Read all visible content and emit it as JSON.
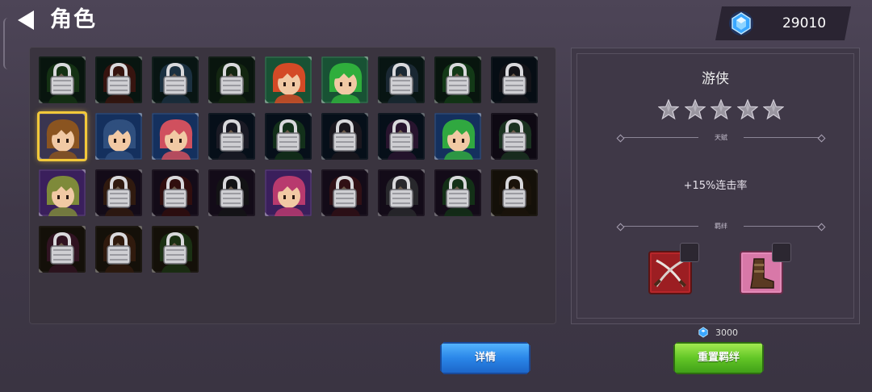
{
  "header": {
    "title": "角色",
    "back_icon": "back-arrow-icon"
  },
  "currency": {
    "icon": "blue-gem-icon",
    "amount": "29010"
  },
  "roster": {
    "slots": [
      {
        "bg": "#12301f",
        "hair": "#2e6e2c",
        "locked": true
      },
      {
        "bg": "#123025",
        "hair": "#7a2e22",
        "locked": true
      },
      {
        "bg": "#12302a",
        "hair": "#3c6a8e",
        "locked": true
      },
      {
        "bg": "#16301f",
        "hair": "#2c5426",
        "locked": true
      },
      {
        "bg": "#185234",
        "hair": "#d44a26",
        "locked": false
      },
      {
        "bg": "#185234",
        "hair": "#2fae3c",
        "locked": false
      },
      {
        "bg": "#12302a",
        "hair": "#3b5a72",
        "locked": true
      },
      {
        "bg": "#123020",
        "hair": "#2a7e34",
        "locked": true
      },
      {
        "bg": "#0f1e2e",
        "hair": "#2c2c36",
        "locked": true
      },
      {
        "bg": "#3a3550",
        "hair": "#8a5420",
        "locked": false
      },
      {
        "bg": "#14305e",
        "hair": "#2f4f7e",
        "locked": false
      },
      {
        "bg": "#14305e",
        "hair": "#d0505e",
        "locked": false
      },
      {
        "bg": "#0f2238",
        "hair": "#3a3a50",
        "locked": true
      },
      {
        "bg": "#0f2238",
        "hair": "#2a6a3a",
        "locked": true
      },
      {
        "bg": "#0f2238",
        "hair": "#3a3444",
        "locked": true
      },
      {
        "bg": "#0f2238",
        "hair": "#5a2e66",
        "locked": true
      },
      {
        "bg": "#14305e",
        "hair": "#30a840",
        "locked": false
      },
      {
        "bg": "#20142c",
        "hair": "#3a6f48",
        "locked": true
      },
      {
        "bg": "#3a1f5c",
        "hair": "#7e8a3a",
        "locked": false
      },
      {
        "bg": "#2a1a36",
        "hair": "#6a3a22",
        "locked": true
      },
      {
        "bg": "#2a1a36",
        "hair": "#6a2020",
        "locked": true
      },
      {
        "bg": "#2a1a36",
        "hair": "#2c2c30",
        "locked": true
      },
      {
        "bg": "#3a1f5c",
        "hair": "#b83a6e",
        "locked": false
      },
      {
        "bg": "#2a1a36",
        "hair": "#6a2430",
        "locked": true
      },
      {
        "bg": "#2a1a36",
        "hair": "#5a5a62",
        "locked": true
      },
      {
        "bg": "#2a1a36",
        "hair": "#2a6a34",
        "locked": true
      },
      {
        "bg": "#2e2414",
        "hair": "#3a2a18",
        "locked": true
      },
      {
        "bg": "#2e2414",
        "hair": "#6a2a4a",
        "locked": true
      },
      {
        "bg": "#2e2414",
        "hair": "#6a3a1e",
        "locked": true
      },
      {
        "bg": "#2e2414",
        "hair": "#3a6a2a",
        "locked": true
      }
    ],
    "selected_index": 9
  },
  "detail": {
    "hero_name": "游侠",
    "stars": 5,
    "talent_label": "天赋",
    "talent_text": "+15%连击率",
    "bond_label": "羁绊",
    "bond_items": [
      {
        "icon": "crossed-swords-icon"
      },
      {
        "icon": "boots-icon"
      }
    ]
  },
  "cost": {
    "icon": "blue-gem-icon",
    "value": "3000"
  },
  "buttons": {
    "details": "详情",
    "reset_bond": "重置羁绊"
  },
  "colors": {
    "select_gold": "#f2c83a",
    "button_blue": "#2a86e8",
    "button_green": "#62c626"
  }
}
